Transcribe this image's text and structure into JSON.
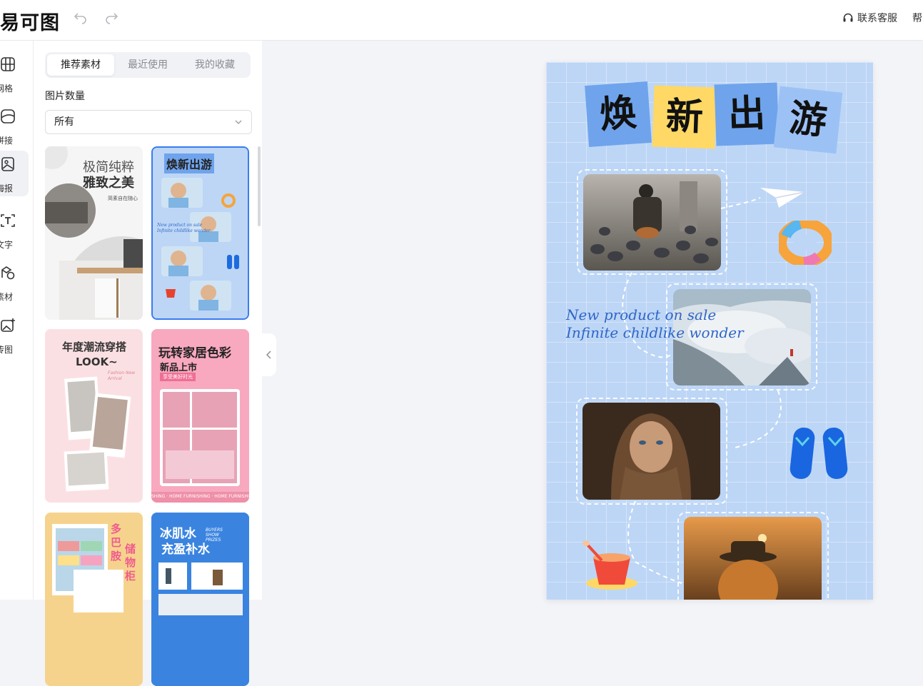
{
  "header": {
    "logo": "易可图",
    "service_label": "联系客服",
    "help_label": "帮"
  },
  "rail": {
    "items": [
      {
        "label": "网格",
        "icon": "grid-icon"
      },
      {
        "label": "拼接",
        "icon": "collage-icon"
      },
      {
        "label": "海报",
        "icon": "poster-icon"
      },
      {
        "label": "文字",
        "icon": "text-icon"
      },
      {
        "label": "素材",
        "icon": "material-icon"
      },
      {
        "label": "传图",
        "icon": "upload-image-icon"
      }
    ],
    "active": "海报"
  },
  "panel": {
    "tabs": [
      "推荐素材",
      "最近使用",
      "我的收藏"
    ],
    "active_tab": "推荐素材",
    "count_label": "图片数量",
    "count_select_value": "所有",
    "cards": [
      {
        "title": "极简纯粹",
        "subtitle": "雅致之美",
        "caption": "简素自在随心"
      },
      {
        "title": "焕新出游",
        "script": "New product on sale",
        "script2": "Infinite childlike wonder"
      },
      {
        "title": "年度潮流穿搭",
        "subtitle": "LOOK~",
        "caption": "Fashion New Arrival"
      },
      {
        "title": "玩转家居色彩",
        "subtitle": "新品上市",
        "caption": "享受美好时光",
        "footer": "SHING · HOME FURNISHING · HOME FURNISHI"
      },
      {
        "title": "多巴胺",
        "subtitle": "储物柜"
      },
      {
        "title": "冰肌水",
        "subtitle": "充盈补水",
        "caption": "BUYERS SHOW PRIZES"
      }
    ]
  },
  "poster": {
    "title_chars": [
      "焕",
      "新",
      "出",
      "游"
    ],
    "script_line1": "New product on sale",
    "script_line2": "Infinite childlike wonder"
  },
  "colors": {
    "accent": "#3a7bf0",
    "poster_bg": "#bdd6f6",
    "tile_blue": "#6fa4ec",
    "tile_yellow": "#ffd866",
    "script_blue": "#2f66c9"
  }
}
